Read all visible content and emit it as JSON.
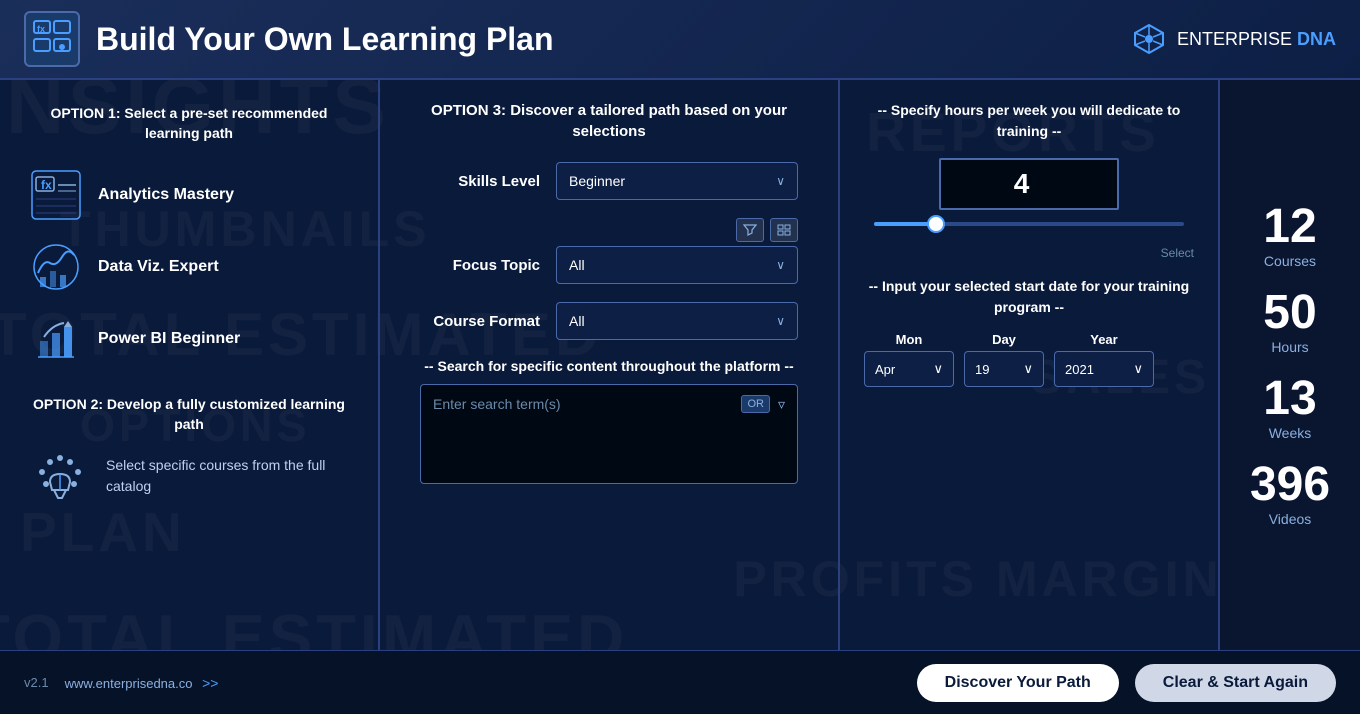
{
  "header": {
    "title": "Build Your Own Learning Plan",
    "brand_name": "ENTERPRISE",
    "brand_highlight": "DNA"
  },
  "footer": {
    "version": "v2.1",
    "url": "www.enterprisedna.co",
    "discover_btn": "Discover Your Path",
    "clear_btn": "Clear & Start Again"
  },
  "left_panel": {
    "option1_title": "OPTION 1: Select a pre-set recommended learning path",
    "paths": [
      {
        "label": "Analytics Mastery"
      },
      {
        "label": "Data Viz. Expert"
      },
      {
        "label": "Power BI Beginner"
      }
    ],
    "option2_title": "OPTION 2: Develop a fully customized learning path",
    "option2_text": "Select specific courses from the full catalog"
  },
  "mid_panel": {
    "option3_title": "OPTION 3: Discover a tailored path based on your selections",
    "skills_label": "Skills Level",
    "skills_value": "Beginner",
    "focus_label": "Focus Topic",
    "focus_value": "All",
    "format_label": "Course Format",
    "format_value": "All",
    "search_title": "-- Search for specific content throughout the platform --",
    "search_placeholder": "Enter search term(s)",
    "or_text": "OR"
  },
  "right_panel": {
    "hours_title": "-- Specify hours per week you will dedicate to training --",
    "hours_value": "4",
    "select_label": "Select",
    "date_title": "-- Input your selected start date for your training program --",
    "month_label": "Mon",
    "month_value": "Apr",
    "day_label": "Day",
    "day_value": "19",
    "year_label": "Year",
    "year_value": "2021"
  },
  "stats": {
    "courses_num": "12",
    "courses_label": "Courses",
    "hours_num": "50",
    "hours_label": "Hours",
    "weeks_num": "13",
    "weeks_label": "Weeks",
    "videos_num": "396",
    "videos_label": "Videos"
  },
  "watermarks": [
    "INSIGHTS",
    "THUMBNAILS",
    "TOTAL EST.",
    "OPTIONS",
    "SALES",
    "PROFITS",
    "MARGINS",
    "REPORTS"
  ]
}
